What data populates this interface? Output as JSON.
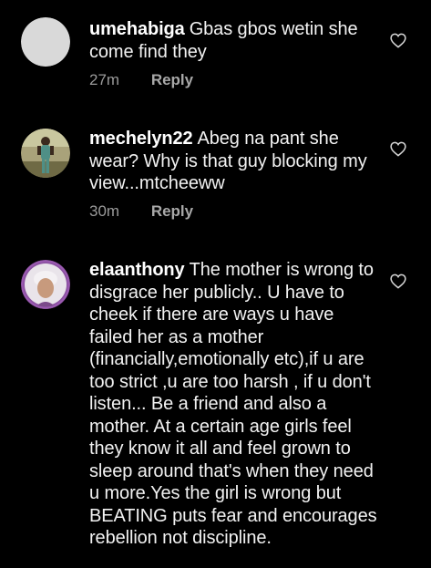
{
  "comments": [
    {
      "username": "umehabiga",
      "text": "Gbas gbos wetin she come find they",
      "time": "27m",
      "reply_label": "Reply",
      "avatar": "default-avatar"
    },
    {
      "username": "mechelyn22",
      "text": "Abeg na pant she wear? Why is that guy blocking my view...mtcheeww",
      "time": "30m",
      "reply_label": "Reply",
      "avatar": "photo-person-standing"
    },
    {
      "username": "elaanthony",
      "text": "The mother is wrong to disgrace her publicly.. U have to cheek if there are ways u have failed her as a mother (financially,emotionally etc),if u are too strict ,u are too harsh , if u don't listen... Be a friend and also a mother. At a certain age girls feel they know it all and feel grown to sleep around that's when they need u more.Yes the girl is wrong but BEATING puts fear and encourages rebellion not discipline.",
      "avatar": "photo-woman-headwrap"
    }
  ],
  "icons": {
    "like": "heart-outline-icon"
  },
  "colors": {
    "background": "#000000",
    "text": "#f2f2f2",
    "meta": "#9a9a9a"
  }
}
